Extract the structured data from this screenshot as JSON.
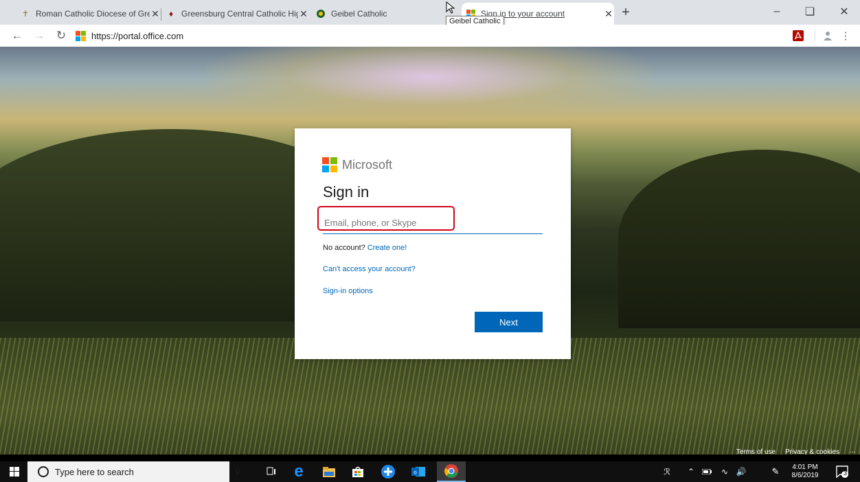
{
  "browser": {
    "tabs": [
      {
        "title": "Roman Catholic Diocese of Gree",
        "active": false
      },
      {
        "title": "Greensburg Central Catholic Hig",
        "active": false
      },
      {
        "title": "Geibel Catholic",
        "active": false
      },
      {
        "title": "Sign in to your account",
        "active": true
      }
    ],
    "tooltip": "Geibel Catholic",
    "url": "https://portal.office.com"
  },
  "signin": {
    "brand": "Microsoft",
    "title": "Sign in",
    "email_placeholder": "Email, phone, or Skype",
    "email_value": "",
    "no_account_text": "No account?",
    "create_link": "Create one!",
    "cant_access_link": "Can't access your account?",
    "signin_options_link": "Sign-in options",
    "next_label": "Next"
  },
  "footer": {
    "terms": "Terms of use",
    "privacy": "Privacy & cookies",
    "more": "···"
  },
  "taskbar": {
    "search_placeholder": "Type here to search",
    "time": "4:01 PM",
    "date": "8/6/2019",
    "notification_count": "3"
  },
  "colors": {
    "accent": "#0067b8",
    "highlight_box": "#d0021b",
    "ms_red": "#f25022",
    "ms_green": "#7fba00",
    "ms_blue": "#00a4ef",
    "ms_yellow": "#ffb900"
  }
}
